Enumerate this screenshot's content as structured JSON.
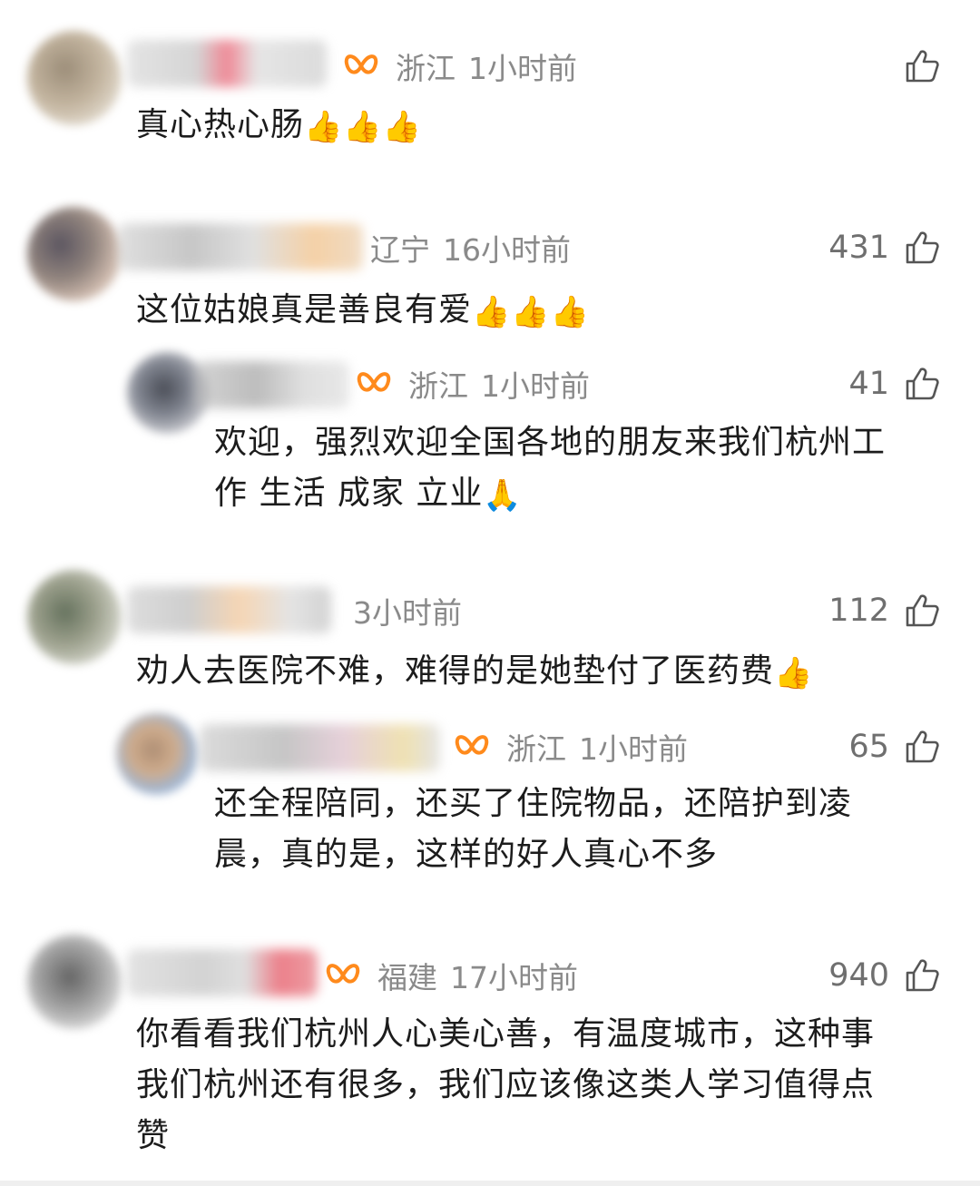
{
  "comments": [
    {
      "location": "浙江",
      "time": "1小时前",
      "likes": "",
      "text": "真心热心肠",
      "emoji": "👍👍👍"
    },
    {
      "location": "辽宁",
      "time": "16小时前",
      "likes": "431",
      "text": "这位姑娘真是善良有爱",
      "emoji": "👍👍👍",
      "reply": {
        "location": "浙江",
        "time": "1小时前",
        "likes": "41",
        "text_line1": "欢迎，强烈欢迎全国各地的朋友来我们杭州工",
        "text_line2": "作 生活 成家 立业",
        "emoji": "🙏"
      }
    },
    {
      "location": "",
      "time": "3小时前",
      "likes": "112",
      "text": "劝人去医院不难，难得的是她垫付了医药费",
      "emoji": "👍",
      "reply": {
        "location": "浙江",
        "time": "1小时前",
        "likes": "65",
        "text_line1": "还全程陪同，还买了住院物品，还陪护到凌",
        "text_line2": "晨，真的是，这样的好人真心不多"
      }
    },
    {
      "location": "福建",
      "time": "17小时前",
      "likes": "940",
      "text_line1": "你看看我们杭州人心美心善，有温度城市，这种事",
      "text_line2": "我们杭州还有很多，我们应该像这类人学习值得点",
      "text_line3": "赞"
    }
  ],
  "icons": {
    "like": "thumb-up-outline-icon",
    "badge": "orange-butterfly-badge-icon"
  },
  "colors": {
    "meta_text": "#8a8a8a",
    "body_text": "#1c1c1c",
    "badge": "#ff8a1c"
  }
}
